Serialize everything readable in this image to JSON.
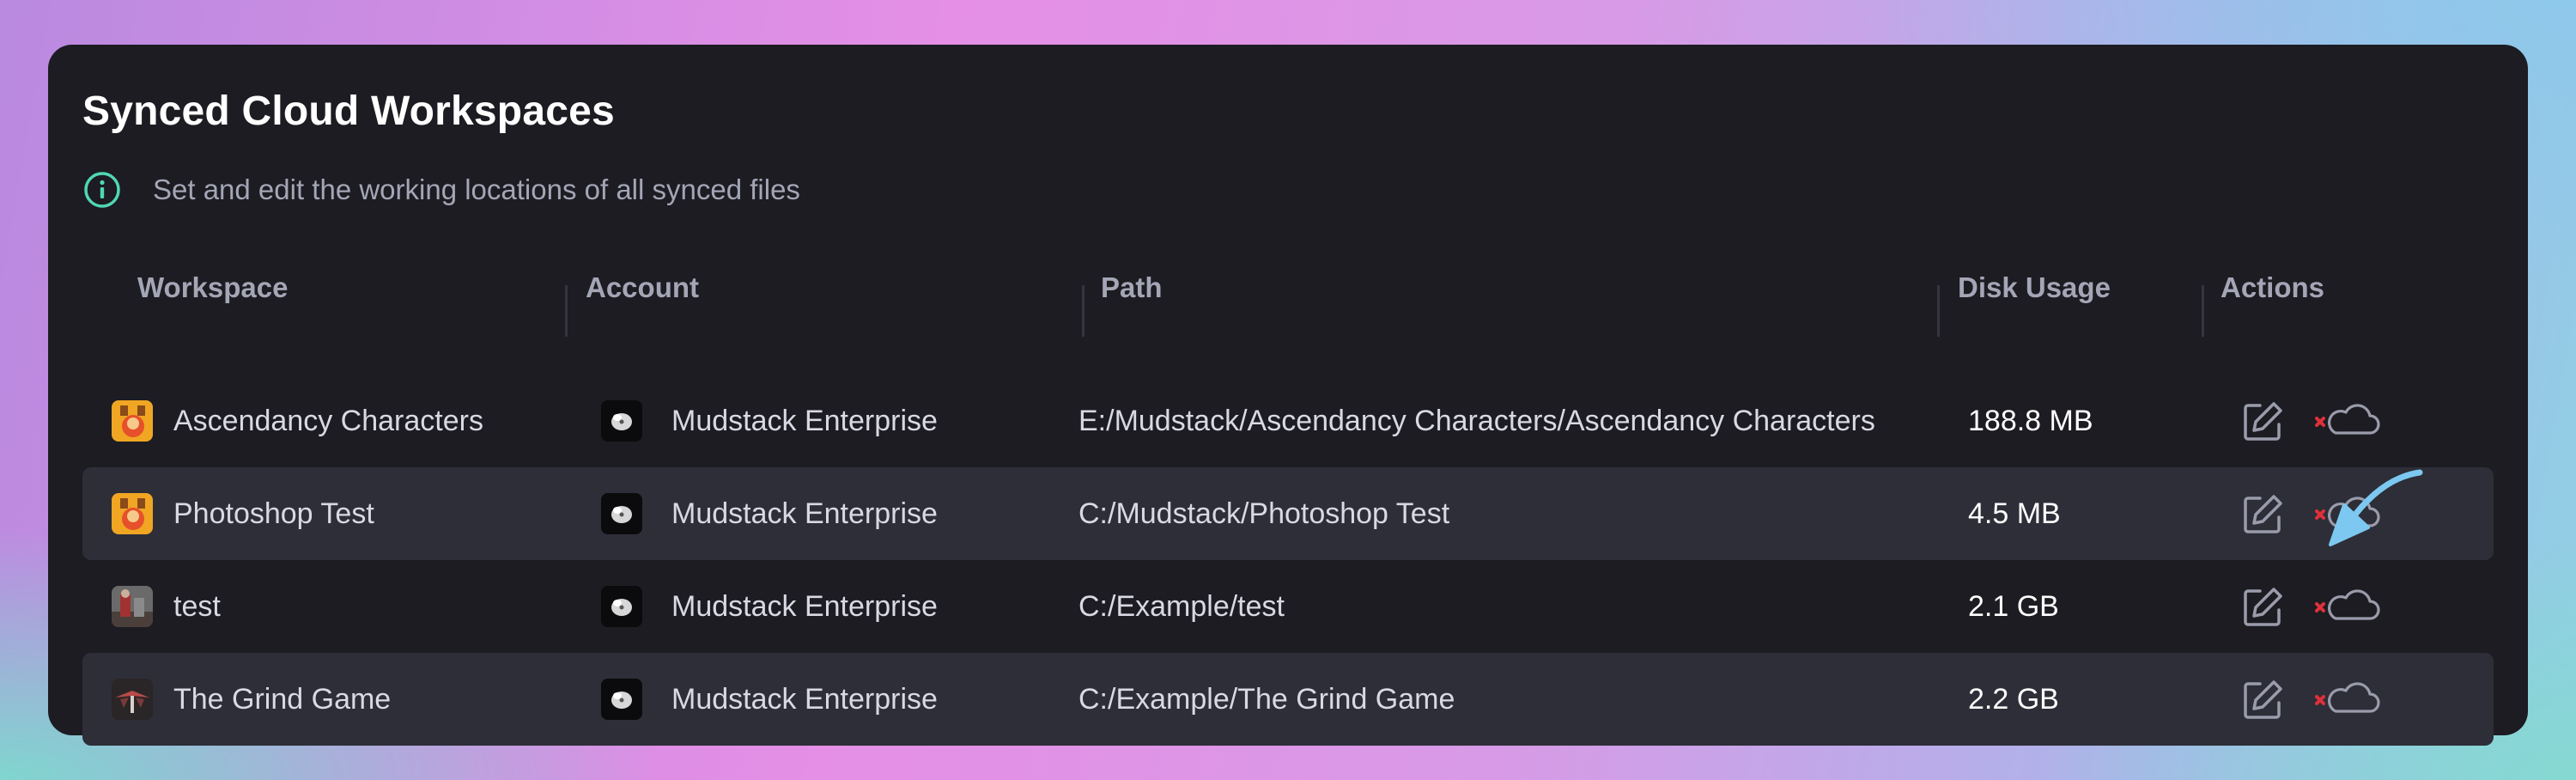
{
  "header": {
    "title": "Synced Cloud Workspaces",
    "subtitle": "Set and edit the working locations of all synced files",
    "info_icon": "info-circle-icon"
  },
  "columns": {
    "workspace": "Workspace",
    "account": "Account",
    "path": "Path",
    "disk_usage": "Disk Usage",
    "actions": "Actions"
  },
  "rows": [
    {
      "workspace": "Ascendancy Characters",
      "workspace_icon": "ascendancy-thumbnail-icon",
      "account": "Mudstack Enterprise",
      "account_icon": "mudstack-logo-icon",
      "path": "E:/Mudstack/Ascendancy Characters/Ascendancy Characters",
      "disk_usage": "188.8 MB"
    },
    {
      "workspace": "Photoshop Test",
      "workspace_icon": "ascendancy-thumbnail-icon",
      "account": "Mudstack Enterprise",
      "account_icon": "mudstack-logo-icon",
      "path": "C:/Mudstack/Photoshop Test",
      "disk_usage": "4.5 MB"
    },
    {
      "workspace": "test",
      "workspace_icon": "test-thumbnail-icon",
      "account": "Mudstack Enterprise",
      "account_icon": "mudstack-logo-icon",
      "path": "C:/Example/test",
      "disk_usage": "2.1 GB"
    },
    {
      "workspace": "The Grind Game",
      "workspace_icon": "grind-game-thumbnail-icon",
      "account": "Mudstack Enterprise",
      "account_icon": "mudstack-logo-icon",
      "path": "C:/Example/The Grind Game",
      "disk_usage": "2.2 GB"
    }
  ],
  "action_icons": {
    "edit": "edit-icon",
    "unsync": "cloud-x-icon"
  },
  "colors": {
    "card_bg": "#1c1c22",
    "row_alt_bg": "#2d2e38",
    "info_accent": "#4fd8b4",
    "unsync_x": "#e0303a",
    "arrow": "#7cc8f0"
  }
}
